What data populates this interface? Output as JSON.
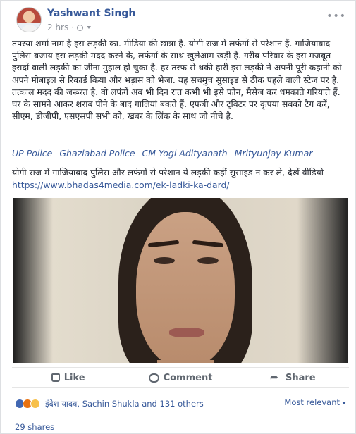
{
  "post": {
    "author": "Yashwant Singh",
    "time": "2 hrs",
    "meta_sep": "·",
    "more": "•••",
    "text": "तपस्या शर्मा नाम है इस लड़की का. मीडिया की छात्रा है. योगी राज में लफंगों से परेशान हैं. गाजियाबाद पुलिस बजाय इस लड़की मदद करने के, लफंगों के साथ खुलेआम खड़ी है. गरीब परिवार के इस मजबूत इरादों वाली लड़की का जीना मुहाल हो चुका है. हर तरफ से थकी हारी इस लड़की ने अपनी पूरी कहानी को अपने मोबाइल से रिकार्ड किया और भड़ास को भेजा. यह सचमुच सुसाइड से ठीक पहले वाली स्टेज पर है. तत्काल मदद की जरूरत है. वो लफंगें अब भी दिन रात कभी भी इसे फोन, मैसेज कर धमकाते गरियाते हैं. घर के सामने आकर शराब पीने के बाद गालियां बकते हैं. एफबी और ट्विटर पर कृपया सबको टैग करें, सीएम, डीजीपी, एसएसपी सभी को, खबर के लिंक के साथ जो नीचे है.",
    "tags": [
      "UP Police",
      "Ghaziabad Police",
      "CM Yogi Adityanath",
      "Mrityunjay Kumar"
    ],
    "text2": "योगी राज में गाजियाबाद पुलिस और लफंगों से परेशान ये लड़की कहीं सुसाइड न कर ले, देखें वीडियो",
    "link": "https://www.bhadas4media.com/ek-ladki-ka-dard/"
  },
  "actions": {
    "like": "Like",
    "comment": "Comment",
    "share": "Share"
  },
  "reactions": {
    "names": "इंदेश यादव, Sachin Shukla and 131 others",
    "sort": "Most relevant"
  },
  "shares": "29 shares",
  "icons": {
    "avatar": "profile-photo",
    "globe": "globe-icon",
    "like": "like-icon",
    "comment": "comment-icon",
    "share": "share-icon"
  },
  "colors": {
    "link": "#365899",
    "muted": "#90949c",
    "text": "#1d2129"
  }
}
